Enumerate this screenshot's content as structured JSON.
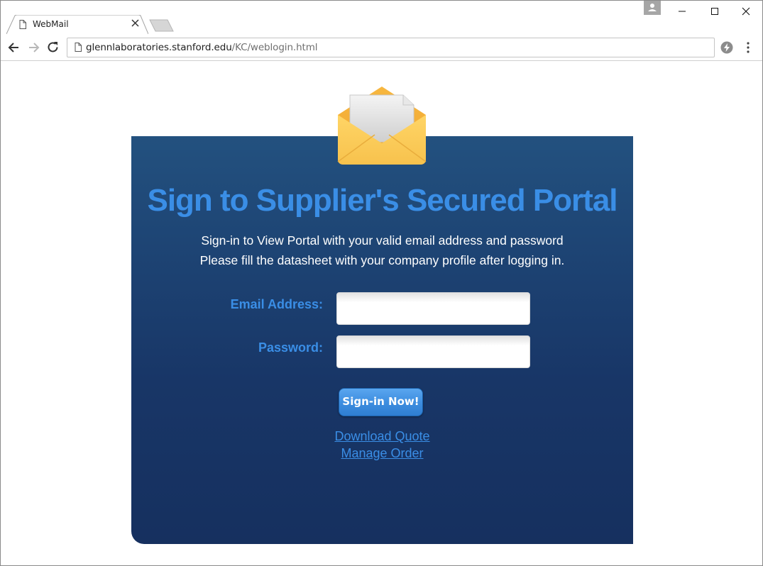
{
  "browser": {
    "tab_title": "WebMail",
    "url_host": "glennlaboratories.stanford.edu",
    "url_path": "/KC/weblogin.html"
  },
  "page": {
    "heading": "Sign to Supplier's Secured Portal",
    "subtext_line1": "Sign-in to View Portal with your valid email address and password",
    "subtext_line2": "Please fill the datasheet with your company profile after logging in.",
    "email_label": "Email Address:",
    "email_value": "",
    "password_label": "Password:",
    "password_value": "",
    "signin_button": "Sign-in Now!",
    "link_download": "Download Quote",
    "link_manage": "Manage Order"
  },
  "colors": {
    "accent": "#3a8ee6",
    "panel_top": "#23517f",
    "panel_bottom": "#16305f"
  },
  "icons": [
    "page-icon",
    "close-icon",
    "back-arrow-icon",
    "forward-arrow-icon",
    "reload-icon",
    "bolt-icon",
    "kebab-menu-icon",
    "envelope-icon",
    "user-icon",
    "minimize-icon",
    "maximize-icon",
    "window-close-icon"
  ]
}
